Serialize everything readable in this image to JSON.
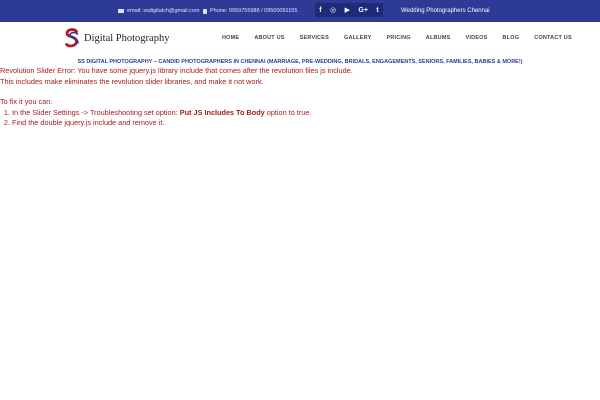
{
  "topbar": {
    "email": "email: ssdigitalch@gmail.com",
    "phone": "Phone: 095975598​8 / 09500091155",
    "tagline": "Wedding Photographers Chennai",
    "social": {
      "facebook": "f",
      "instagram": "◎",
      "youtube": "▶",
      "googleplus": "G+",
      "twitter": "t"
    }
  },
  "header": {
    "logo_text": "Digital Photography",
    "nav": [
      "HOME",
      "ABOUT US",
      "SERVICES",
      "GALLERY",
      "PRICING",
      "ALBUMS",
      "VIDEOS",
      "BLOG",
      "CONTACT US"
    ]
  },
  "banner": "SS DIGITAL PHOTOGRAPHY – CANDID PHOTOGRAPHERS IN CHENNAI (MARRIAGE, PRE-WEDDING, BRIDALS, ENGAGEMENTS, SENIORS, FAMILIES, BABIES & MORE!)",
  "error": {
    "line1": "Revolution Slider Error: You have some jquery.js library include that comes after the revolution files js include.",
    "line2": "This includes make eliminates the revolution slider libraries, and make it not work.",
    "fix_heading": "To fix it you can:",
    "step1_prefix": "In the Slider Settings -> Troubleshooting set option: ",
    "step1_bold": "Put JS Includes To Body",
    "step1_suffix": " option to true.",
    "step2": "Find the double jquery.js include and remove it."
  },
  "colors": {
    "topbar_bg": "#2e3b96",
    "social_bg": "#1f2a78",
    "banner_text": "#2e3b96",
    "error_text": "#a61b1b"
  }
}
